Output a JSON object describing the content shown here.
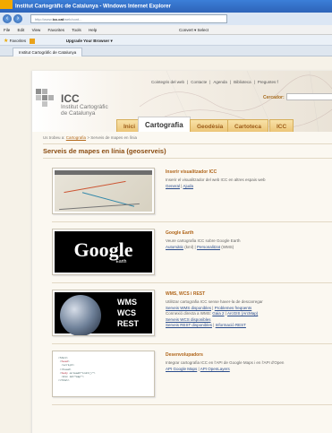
{
  "browser": {
    "title": "Institut Cartogràfic de Catalunya - Windows Internet Explorer",
    "url_pre": "http://www.",
    "url_host": "icc.cat",
    "url_post": "/web/cont...",
    "menu": [
      "File",
      "Edit",
      "View",
      "Favorites",
      "Tools",
      "Help"
    ],
    "menu_right": "Convert ▾   Select",
    "favorites_label": "Favorites",
    "upgrade": "Upgrade Your Browser ▾",
    "tab_label": "Institut Cartogràfic de Catalunya"
  },
  "site": {
    "logo_title": "ICC",
    "logo_sub1": "Institut Cartogràfic",
    "logo_sub2": "de Catalunya",
    "toplinks": [
      "Cointegris del web",
      "|",
      "Contacte",
      "|",
      "Agenda",
      "|",
      "Biblioteca",
      "|",
      "Preguntes f"
    ],
    "search_label": "Cercador:",
    "tabs": [
      "Inici",
      "Cartografia",
      "Geodèsia",
      "Cartoteca",
      "ICC"
    ]
  },
  "breadcrumb": {
    "prefix": "Us trobeu a:",
    "link": "Cartografia",
    "rest": "> Serveis de mapes en línia"
  },
  "heading": "Serveis de mapes en línia (geoserveis)",
  "items": [
    {
      "title": "Inserir visualitzador ICC",
      "desc": "Inserir el visualitzador del web ICC en altres espais web",
      "links": [
        "General",
        "Ajuda"
      ],
      "sep": "|"
    },
    {
      "title": "Google Earth",
      "desc": "Veure cartografia ICC sobre Google Earth",
      "links": [
        "Automàtic",
        "Personalitzat"
      ],
      "l1_suffix": "(kml)",
      "l2_suffix": "(WMS)",
      "sep": "|"
    },
    {
      "title": "WMS, WCS i REST",
      "desc": "Utilitzar cartografia ICC sense haver-la de descarregar",
      "line2a": "Serveis WMS disponibles",
      "line2b": "Problemes freqüents",
      "line3_pre": "Connexió directa a WMS:",
      "line3_a": "Gaia 2",
      "line3_b": "ArcGIS (ArcMap)",
      "line4": "Serveis WCS disponibles",
      "line5a": "Serveis REST disponibles",
      "line5b": "Informació REST",
      "sep": "|",
      "thumb_words": [
        "WMS",
        "WCS",
        "REST"
      ]
    },
    {
      "title": "Desenvolupadors",
      "desc": "Integrar cartografia ICC en l'API de Google Maps i en l'API d'Open",
      "links": [
        "API Google Maps",
        "API OpenLayers"
      ],
      "sep": "|"
    }
  ],
  "google_thumb": {
    "word": "Google",
    "sub": "Earth"
  }
}
